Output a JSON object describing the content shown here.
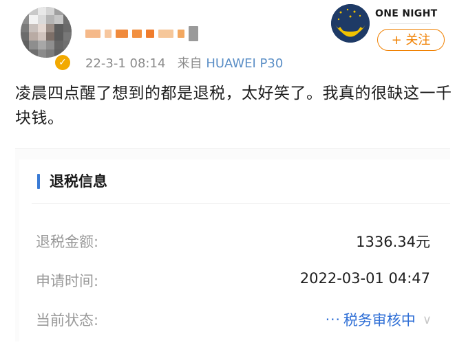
{
  "header": {
    "post_date": "22-3-1 08:14",
    "source_prefix": "来自",
    "device": "HUAWEI P30",
    "verified_icon": "check-icon"
  },
  "brand": {
    "name": "ONE NIGHT",
    "follow_label": "+ 关注"
  },
  "post": {
    "text": "凌晨四点醒了想到的都是退税，太好笑了。我真的很缺这一千块钱。"
  },
  "card": {
    "title": "退税信息",
    "rows": [
      {
        "label": "退税金额:",
        "value": "1336.34元"
      },
      {
        "label": "申请时间:",
        "value": "2022-03-01 04:47"
      },
      {
        "label": "当前状态:",
        "value": "税务审核中"
      }
    ],
    "status_prefix": "···",
    "status_chevron": "∨"
  },
  "colors": {
    "accent_orange": "#f08000",
    "device_blue": "#5a8ec6",
    "status_blue": "#2f6fd6"
  }
}
